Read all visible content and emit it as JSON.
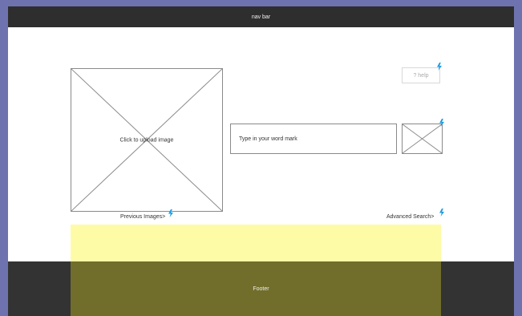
{
  "navbar": {
    "label": "nav bar"
  },
  "upload": {
    "label": "Click to upload image"
  },
  "wordmark": {
    "placeholder": "Type in your word mark"
  },
  "help": {
    "label": "? help"
  },
  "links": {
    "previous_images": "Previous Images>",
    "advanced_search": "Advanced Search>"
  },
  "footer": {
    "label": "Footer"
  },
  "colors": {
    "page_background": "#6e73b0",
    "bar_dark": "#2e2e2e",
    "highlight_yellow": "#fefba6",
    "annotation_blue": "#1e9be0"
  },
  "icons": {
    "annotation": "lightning-bolt-icon",
    "image_placeholder": "image-placeholder-icon"
  }
}
